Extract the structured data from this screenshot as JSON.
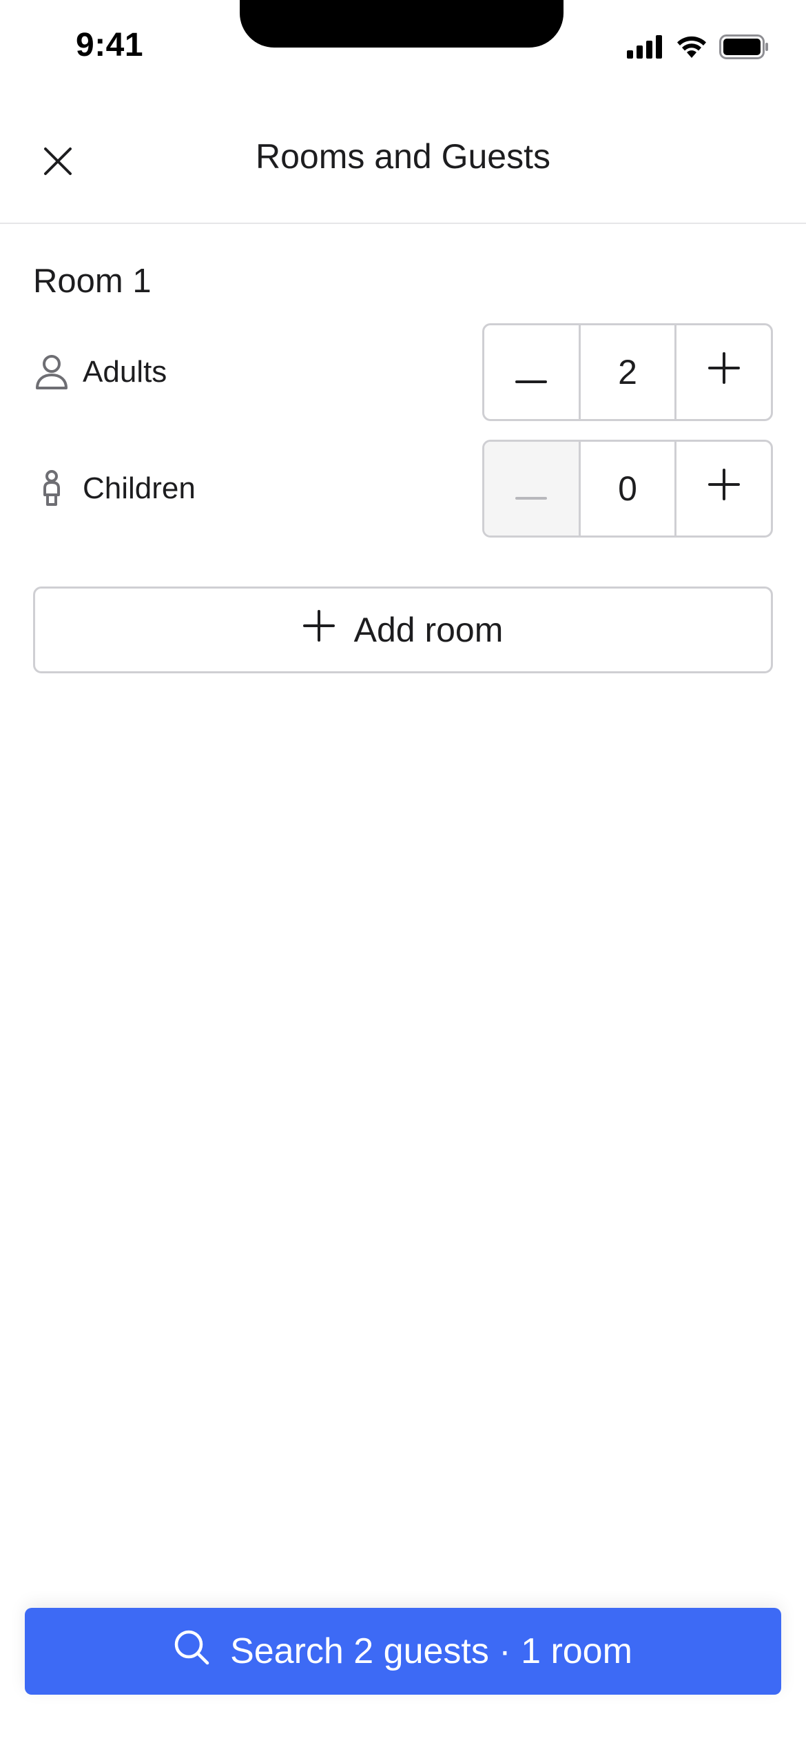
{
  "status_bar": {
    "time": "9:41"
  },
  "header": {
    "title": "Rooms and Guests"
  },
  "room": {
    "title": "Room 1",
    "adults": {
      "label": "Adults",
      "value": "2",
      "decrement_enabled": true
    },
    "children": {
      "label": "Children",
      "value": "0",
      "decrement_enabled": false
    }
  },
  "add_room": {
    "label": "Add room"
  },
  "search_button": {
    "label": "Search 2 guests · 1 room"
  },
  "colors": {
    "accent": "#3d6af5",
    "border": "#cfcfd3",
    "disabled_bg": "#f5f5f5",
    "disabled_icon": "#b8b8bc",
    "text": "#1d1d1f",
    "icon_gray": "#6e6e73"
  },
  "icons": {
    "close": "close-icon",
    "adult": "person-icon",
    "child": "child-icon",
    "minus": "minus-icon",
    "plus": "plus-icon",
    "search": "search-icon",
    "signal": "cellular-signal-icon",
    "wifi": "wifi-icon",
    "battery": "battery-icon"
  }
}
